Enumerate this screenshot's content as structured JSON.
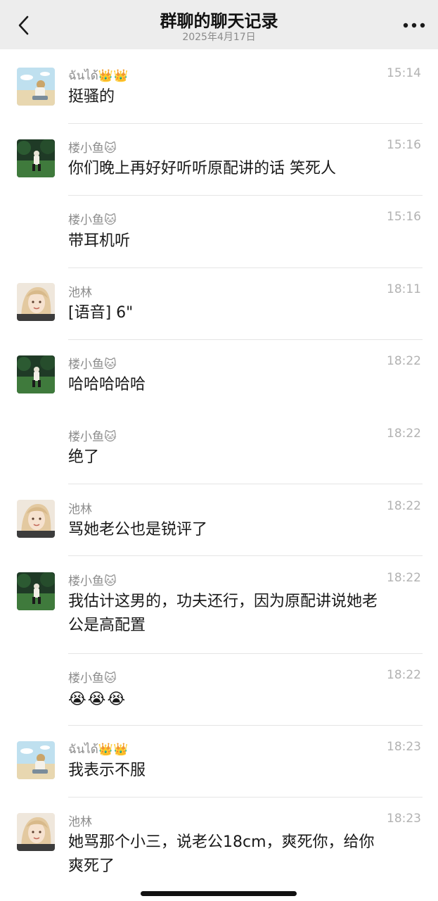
{
  "header": {
    "title": "群聊的聊天记录",
    "date": "2025年4月17日"
  },
  "colors": {
    "header_bg": "#ededed",
    "name": "#8c8c8c",
    "time": "#b2b2b2",
    "text": "#191919",
    "divider": "#e5e5e5"
  },
  "messages": [
    {
      "sender": "ฉันได้👑👑",
      "time": "15:14",
      "text": "挺骚的",
      "avatar": "beach-avatar"
    },
    {
      "sender": "楼小鱼🐱",
      "time": "15:16",
      "text": "你们晚上再好好听听原配讲的话 笑死人",
      "avatar": "field-avatar"
    },
    {
      "sender": "楼小鱼🐱",
      "time": "15:16",
      "text": "带耳机听",
      "avatar": ""
    },
    {
      "sender": "池林",
      "time": "18:11",
      "text": "[语音] 6\"",
      "avatar": "portrait-avatar"
    },
    {
      "sender": "楼小鱼🐱",
      "time": "18:22",
      "text": "哈哈哈哈哈",
      "avatar": "field-avatar"
    },
    {
      "sender": "楼小鱼🐱",
      "time": "18:22",
      "text": "绝了",
      "avatar": ""
    },
    {
      "sender": "池林",
      "time": "18:22",
      "text": "骂她老公也是锐评了",
      "avatar": "portrait-avatar"
    },
    {
      "sender": "楼小鱼🐱",
      "time": "18:22",
      "text_lines": [
        "我估计这男的，功夫还行，因为原配讲说她老",
        "公是高配置"
      ],
      "avatar": "field-avatar"
    },
    {
      "sender": "楼小鱼🐱",
      "time": "18:22",
      "emoji": [
        "😭",
        "😭",
        "😭"
      ],
      "avatar": ""
    },
    {
      "sender": "ฉันได้👑👑",
      "time": "18:23",
      "text": "我表示不服",
      "avatar": "beach-avatar"
    },
    {
      "sender": "池林",
      "time": "18:23",
      "text_lines": [
        "她骂那个小三，说老公18cm，爽死你，给你",
        "爽死了"
      ],
      "avatar": "portrait-avatar"
    }
  ]
}
